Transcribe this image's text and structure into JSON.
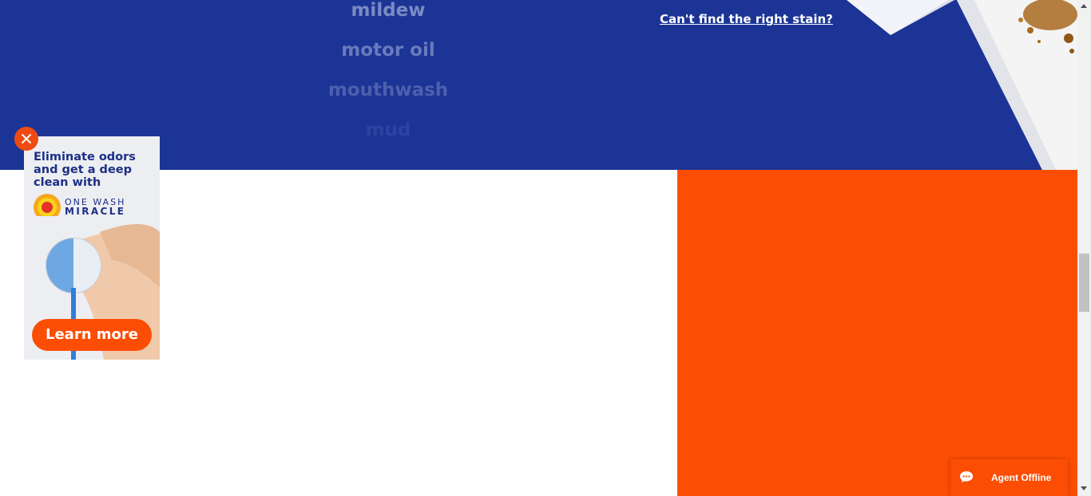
{
  "stain_list": {
    "items": [
      "mildew",
      "motor oil",
      "mouthwash",
      "mud"
    ]
  },
  "cant_find_link": "Can't find the right stain?",
  "ad": {
    "headline": "Eliminate odors and get a deep clean with",
    "brand_logo": "Tide",
    "product_line_1": "ONE WASH",
    "product_line_2": "MIRACLE",
    "cta": "Learn more"
  },
  "chat": {
    "status": "Agent Offline",
    "icon": "chat-bubble-icon"
  },
  "colors": {
    "brand_blue": "#1c3496",
    "brand_orange": "#fc4d04"
  }
}
